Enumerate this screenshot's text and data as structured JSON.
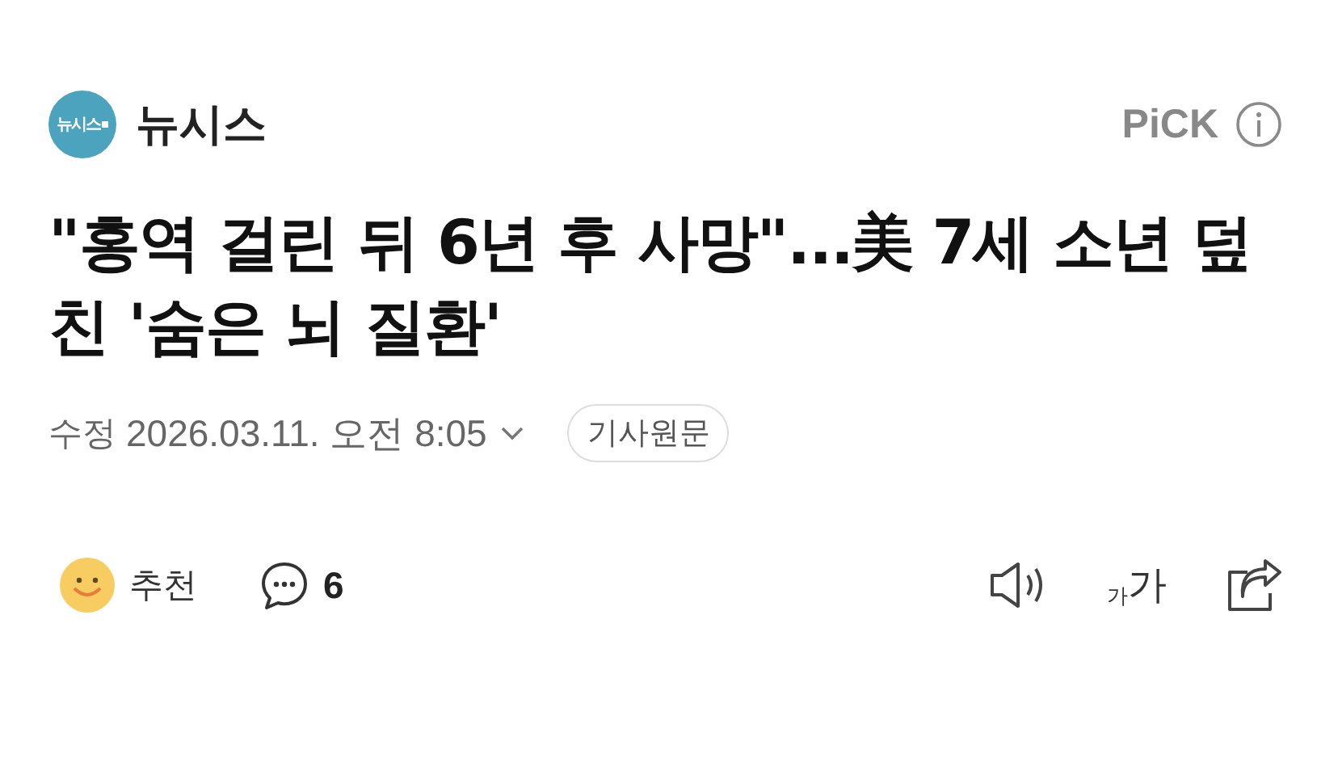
{
  "press": {
    "logo_text": "뉴시스",
    "name": "뉴시스"
  },
  "pick": {
    "label": "PiCK"
  },
  "headline": "\"홍역 걸린 뒤 6년 후 사망\"...美 7세 소년 덮친 '숨은 뇌 질환'",
  "meta": {
    "label": "수정",
    "datetime": "2026.03.11. 오전 8:05",
    "original_button": "기사원문"
  },
  "actions": {
    "recommend": "추천",
    "comment_count": "6",
    "font_size": {
      "small": "가",
      "large": "가"
    }
  }
}
